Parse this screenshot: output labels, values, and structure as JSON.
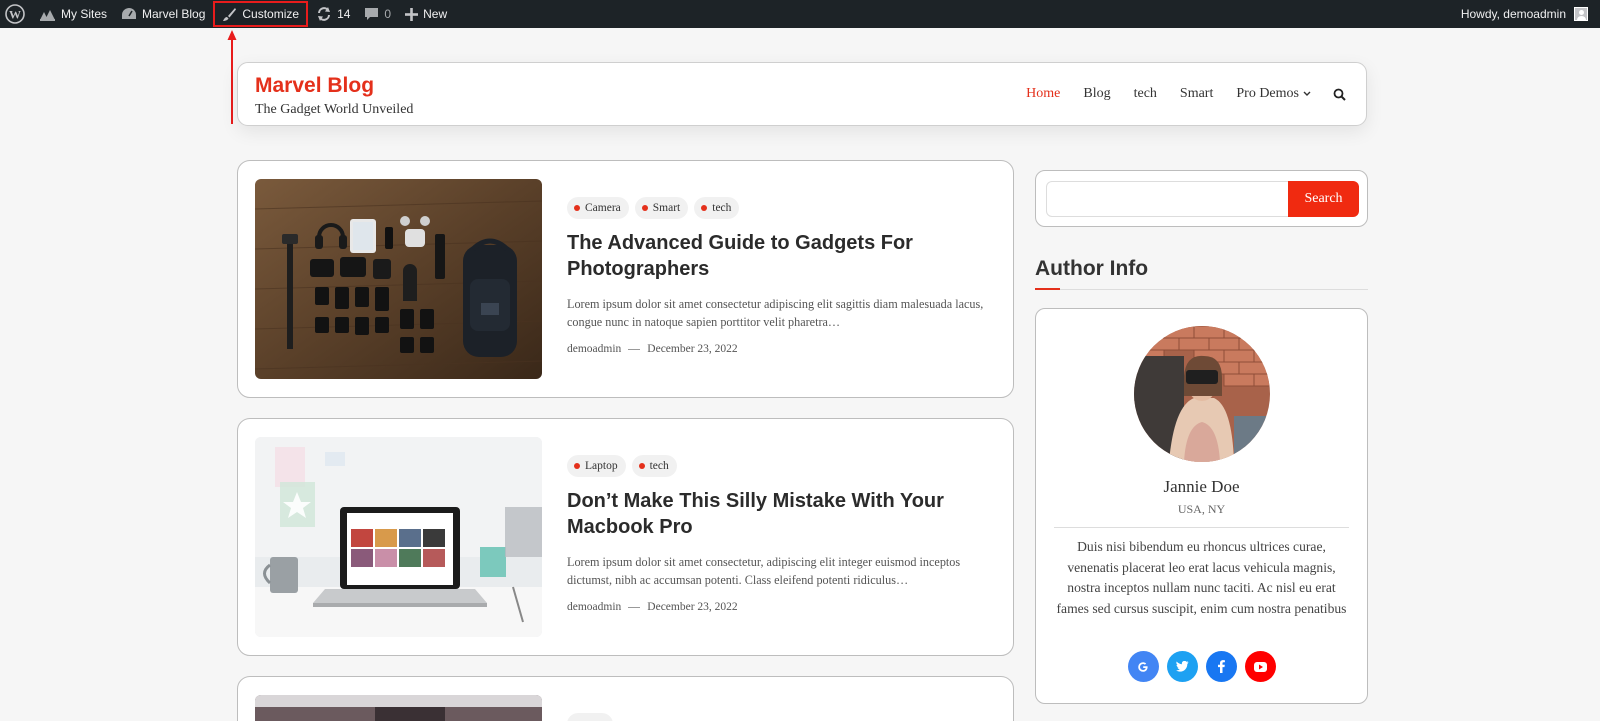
{
  "admin_bar": {
    "my_sites": "My Sites",
    "site_name": "Marvel Blog",
    "customize": "Customize",
    "updates_count": "14",
    "comments_count": "0",
    "new_label": "New",
    "howdy": "Howdy, demoadmin"
  },
  "header": {
    "title": "Marvel Blog",
    "tagline": "The Gadget World Unveiled",
    "nav": [
      {
        "label": "Home",
        "active": true
      },
      {
        "label": "Blog"
      },
      {
        "label": "tech"
      },
      {
        "label": "Smart"
      },
      {
        "label": "Pro Demos"
      }
    ]
  },
  "posts": [
    {
      "categories": [
        "Camera",
        "Smart",
        "tech"
      ],
      "title": "The Advanced Guide to Gadgets For Photographers",
      "excerpt": "Lorem ipsum dolor sit amet consectetur adipiscing elit sagittis diam malesuada lacus, congue nunc in natoque sapien porttitor velit pharetra…",
      "author": "demoadmin",
      "date": "December 23, 2022"
    },
    {
      "categories": [
        "Laptop",
        "tech"
      ],
      "title": "Don’t Make This Silly Mistake With Your Macbook Pro",
      "excerpt": "Lorem ipsum dolor sit amet consectetur, adipiscing elit integer euismod inceptos dictumst, nibh ac accumsan potenti. Class eleifend potenti ridiculus…",
      "author": "demoadmin",
      "date": "December 23, 2022"
    }
  ],
  "sidebar": {
    "search_button": "Search",
    "author_heading": "Author Info",
    "author": {
      "name": "Jannie Doe",
      "location": "USA, NY",
      "bio": "Duis nisi bibendum eu rhoncus ultrices curae, venenatis placerat leo erat lacus vehicula magnis, nostra inceptos nullam nunc taciti. Ac nisl eu erat fames sed cursus suscipit, enim cum nostra penatibus"
    },
    "social": [
      "google-icon",
      "twitter-icon",
      "facebook-icon",
      "youtube-icon"
    ]
  },
  "colors": {
    "accent": "#e4301b",
    "admin_bar": "#1d2327",
    "search_button": "#f02a10"
  }
}
